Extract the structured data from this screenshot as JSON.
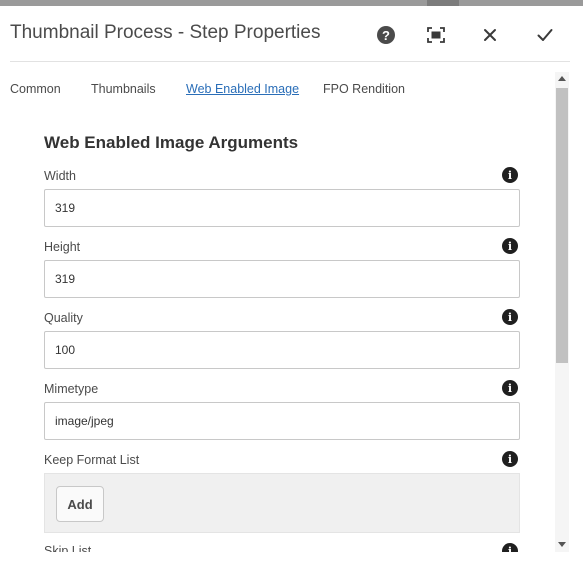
{
  "dialog": {
    "title": "Thumbnail Process - Step Properties",
    "help_icon": "?",
    "actions": [
      "help-icon",
      "fullscreen-icon",
      "close-icon",
      "checkmark-icon"
    ]
  },
  "tabs": [
    {
      "label": "Common",
      "active": false
    },
    {
      "label": "Thumbnails",
      "active": false
    },
    {
      "label": "Web Enabled Image",
      "active": true
    },
    {
      "label": "FPO Rendition",
      "active": false
    }
  ],
  "section": {
    "title": "Web Enabled Image Arguments"
  },
  "fields": {
    "width": {
      "label": "Width",
      "value": "319"
    },
    "height": {
      "label": "Height",
      "value": "319"
    },
    "quality": {
      "label": "Quality",
      "value": "100"
    },
    "mimetype": {
      "label": "Mimetype",
      "value": "image/jpeg"
    },
    "keep_format_list": {
      "label": "Keep Format List",
      "add_label": "Add"
    },
    "skip_list": {
      "label": "Skip List"
    }
  },
  "info_icon": "i",
  "colors": {
    "accent": "#2a6eb8",
    "text": "#4b4b4b",
    "icon_dark": "#1f1f1f",
    "multifield_bg": "#f0f0f0"
  }
}
